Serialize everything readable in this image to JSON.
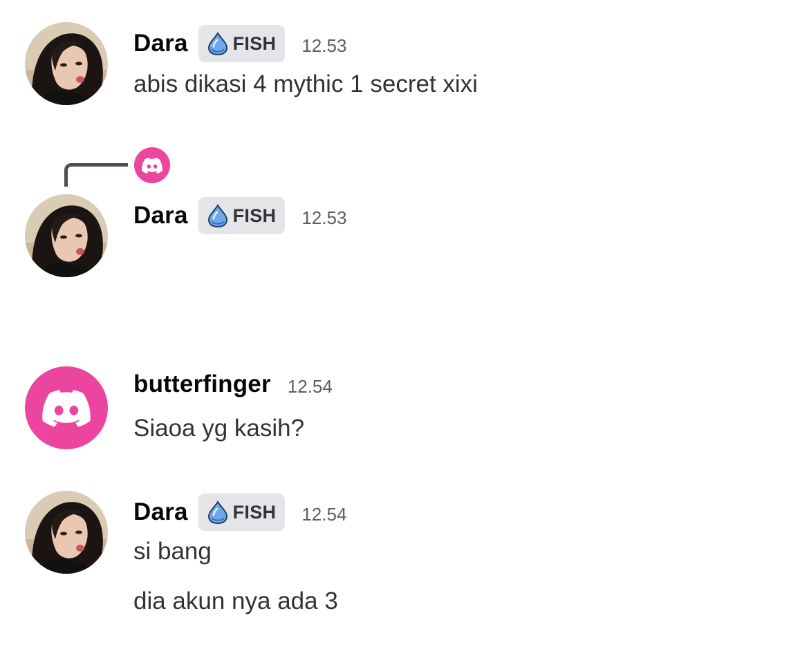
{
  "messages": [
    {
      "username": "Dara",
      "role_tag": "FISH",
      "timestamp": "12.53",
      "lines": [
        "abis dikasi 4 mythic 1 secret xixi"
      ],
      "avatar": "user-photo-avatar"
    },
    {
      "username": "Dara",
      "role_tag": "FISH",
      "timestamp": "12.53",
      "lines": [],
      "avatar": "user-photo-avatar",
      "reply_to_avatar": "discord-logo-icon"
    },
    {
      "username": "butterfinger",
      "timestamp": "12.54",
      "lines": [
        "Siaoa yg kasih?"
      ],
      "avatar": "discord-logo-icon"
    },
    {
      "username": "Dara",
      "role_tag": "FISH",
      "timestamp": "12.54",
      "lines": [
        "si bang",
        "dia akun nya ada 3"
      ],
      "avatar": "user-photo-avatar"
    }
  ],
  "colors": {
    "discord_pink": "#eb459f",
    "tag_background": "#e4e5e8",
    "timestamp_gray": "#5c5e66",
    "reply_spine": "#4e5058"
  },
  "icons": {
    "role_tag_icon": "water-drop-icon",
    "default_avatar": "discord-logo-icon"
  }
}
